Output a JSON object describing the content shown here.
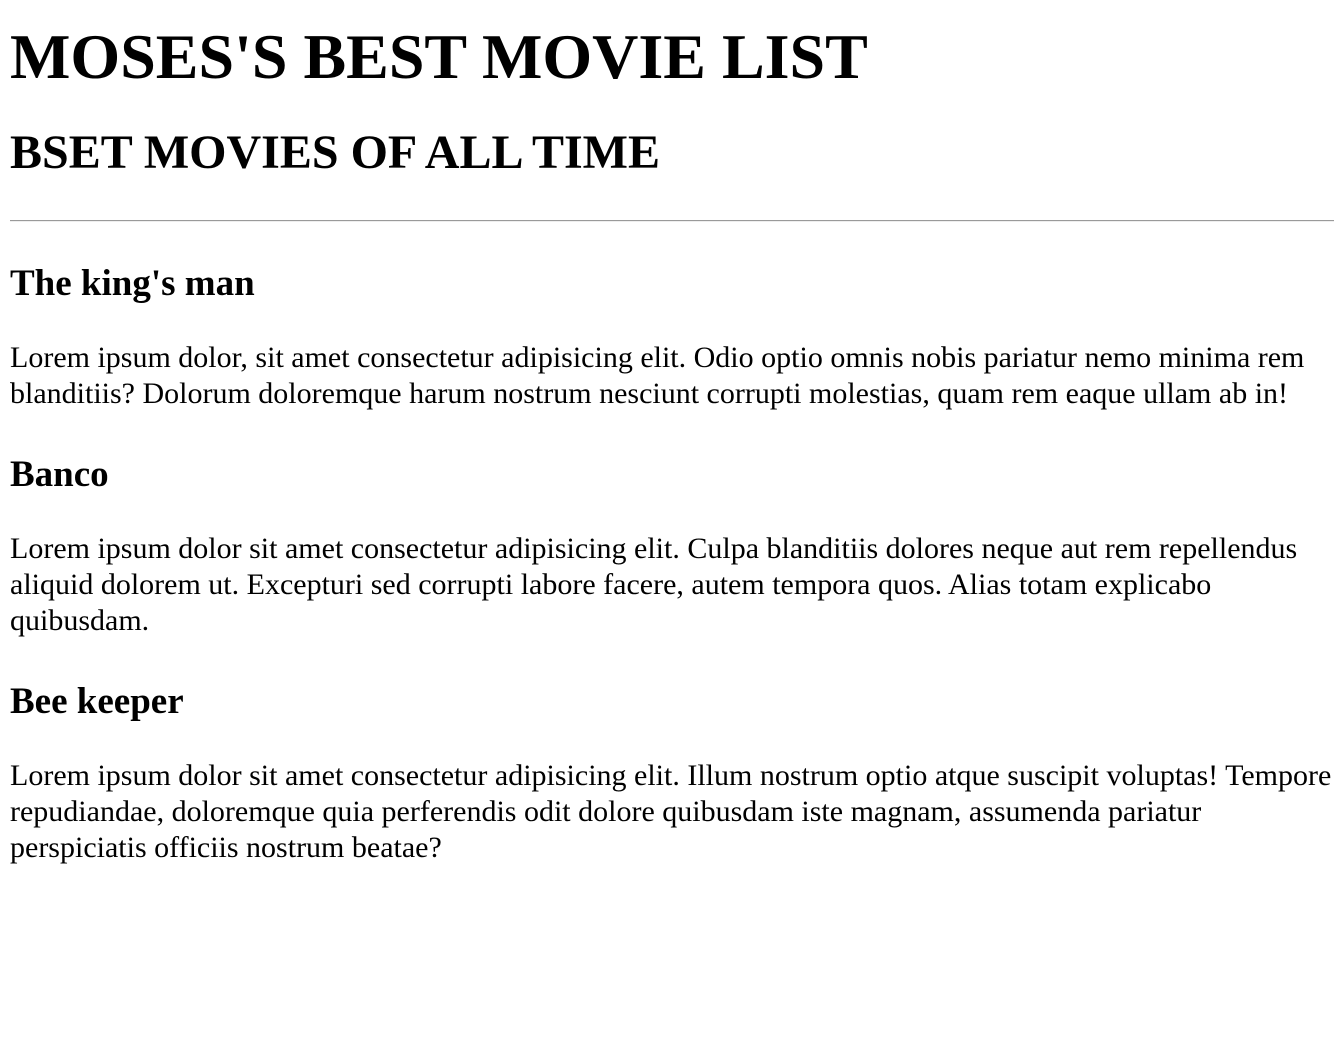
{
  "header": {
    "title": "MOSES'S BEST MOVIE LIST",
    "subtitle": "BSET MOVIES OF ALL TIME"
  },
  "movies": [
    {
      "title": "The king's man",
      "description": "Lorem ipsum dolor, sit amet consectetur adipisicing elit. Odio optio omnis nobis pariatur nemo minima rem blanditiis? Dolorum doloremque harum nostrum nesciunt corrupti molestias, quam rem eaque ullam ab in!"
    },
    {
      "title": "Banco",
      "description": "Lorem ipsum dolor sit amet consectetur adipisicing elit. Culpa blanditiis dolores neque aut rem repellendus aliquid dolorem ut. Excepturi sed corrupti labore facere, autem tempora quos. Alias totam explicabo quibusdam."
    },
    {
      "title": "Bee keeper",
      "description": "Lorem ipsum dolor sit amet consectetur adipisicing elit. Illum nostrum optio atque suscipit voluptas! Tempore repudiandae, doloremque quia perferendis odit dolore quibusdam iste magnam, assumenda pariatur perspiciatis officiis nostrum beatae?"
    }
  ]
}
